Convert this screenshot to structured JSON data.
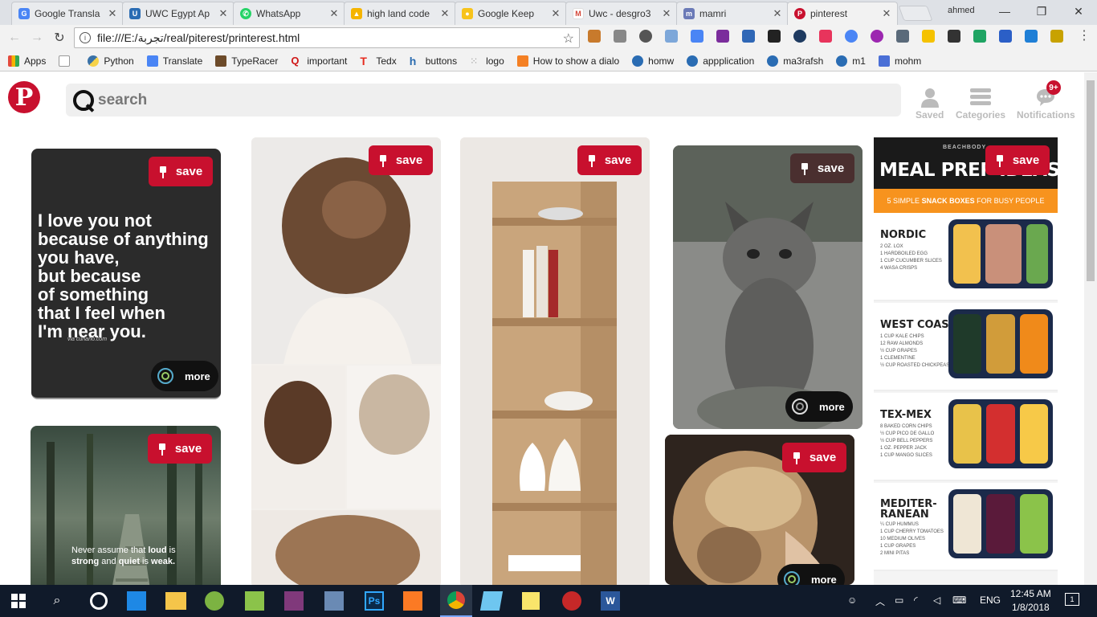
{
  "browser": {
    "tabs": [
      {
        "title": "Google Transla",
        "color": "#4a85f5",
        "glyph": "G"
      },
      {
        "title": "UWC Egypt Ap",
        "color": "#2a6cb3",
        "glyph": "U"
      },
      {
        "title": "WhatsApp",
        "color": "#25d366",
        "glyph": "W"
      },
      {
        "title": "high land code",
        "color": "#f5b400",
        "glyph": "▲"
      },
      {
        "title": "Google Keep",
        "color": "#f7c31b",
        "glyph": "K"
      },
      {
        "title": "Uwc - desgro3",
        "color": "#d44638",
        "glyph": "M"
      },
      {
        "title": "mamri",
        "color": "#6b7ab7",
        "glyph": "m"
      },
      {
        "title": "pinterest",
        "color": "#c8102e",
        "glyph": "P"
      }
    ],
    "window_user": "ahmed",
    "url": "file:///E:/تجربة/real/piterest/printerest.html",
    "bookmarks": [
      {
        "label": "Apps",
        "color": "#e34a3c"
      },
      {
        "label": "",
        "color": "#bbb"
      },
      {
        "label": "Python",
        "color": "#3a72a8"
      },
      {
        "label": "Translate",
        "color": "#4a85f5"
      },
      {
        "label": "TypeRacer",
        "color": "#6d4b2a"
      },
      {
        "label": "important",
        "color": "#d01818"
      },
      {
        "label": "Tedx",
        "color": "#e62b1e"
      },
      {
        "label": "buttons",
        "color": "#2b6cb0"
      },
      {
        "label": "logo",
        "color": "#999"
      },
      {
        "label": "How to show a dialo",
        "color": "#f48024"
      },
      {
        "label": "homw",
        "color": "#2a6cb3"
      },
      {
        "label": "appplication",
        "color": "#2a6cb3"
      },
      {
        "label": "ma3rafsh",
        "color": "#2a6cb3"
      },
      {
        "label": "m1",
        "color": "#2a6cb3"
      },
      {
        "label": "mohm",
        "color": "#4a6fd6"
      }
    ]
  },
  "header": {
    "search_placeholder": "search",
    "saved_label": "Saved",
    "categories_label": "Categories",
    "notifications_label": "Notifications",
    "notifications_badge": "9+"
  },
  "pins": {
    "save_label": "save",
    "more_label": "more",
    "quote_lines": [
      "I love you not",
      "because of anything",
      "you have,",
      "but because",
      "of something",
      "that I feel when",
      "I'm near you."
    ],
    "quote_credit": "via curiano.com",
    "forest_text_1": "Never assume that ",
    "forest_loud": "loud",
    "forest_text_2": " is",
    "forest_strong": "strong",
    "forest_text_3": " and ",
    "forest_quiet": "quiet",
    "forest_text_4": " is ",
    "forest_weak": "weak.",
    "meal": {
      "brand": "BEACHBODY",
      "title": "MEAL PREP IDEAS",
      "subtitle_1": "5 SIMPLE ",
      "subtitle_bold": "SNACK BOXES",
      "subtitle_2": " FOR BUSY PEOPLE",
      "rows": [
        {
          "name": "NORDIC",
          "items": "2 OZ. LOX\n1 HARDBOILED EGG\n1 CUP CUCUMBER SLICES\n4 WASA CRISPS"
        },
        {
          "name": "WEST COAST",
          "items": "1 CUP KALE CHIPS\n12 RAW ALMONDS\n½ CUP GRAPES\n1 CLEMENTINE\n½ CUP ROASTED CHICKPEAS"
        },
        {
          "name": "TEX-MEX",
          "items": "8 BAKED CORN CHIPS\n½ CUP PICO DE GALLO\n½ CUP BELL PEPPERS\n1 OZ. PEPPER JACK\n1 CUP MANGO SLICES"
        },
        {
          "name": "MEDITER-\nRANEAN",
          "items": "¼ CUP HUMMUS\n1 CUP CHERRY TOMATOES\n10 MEDIUM OLIVES\n1 CUP GRAPES\n2 MINI PITAS"
        }
      ]
    }
  },
  "taskbar": {
    "language": "ENG",
    "time": "12:45 AM",
    "date": "1/8/2018",
    "notification_count": "1"
  },
  "colors": {
    "pinterest_red": "#c8102e",
    "taskbar": "#101a2a"
  }
}
